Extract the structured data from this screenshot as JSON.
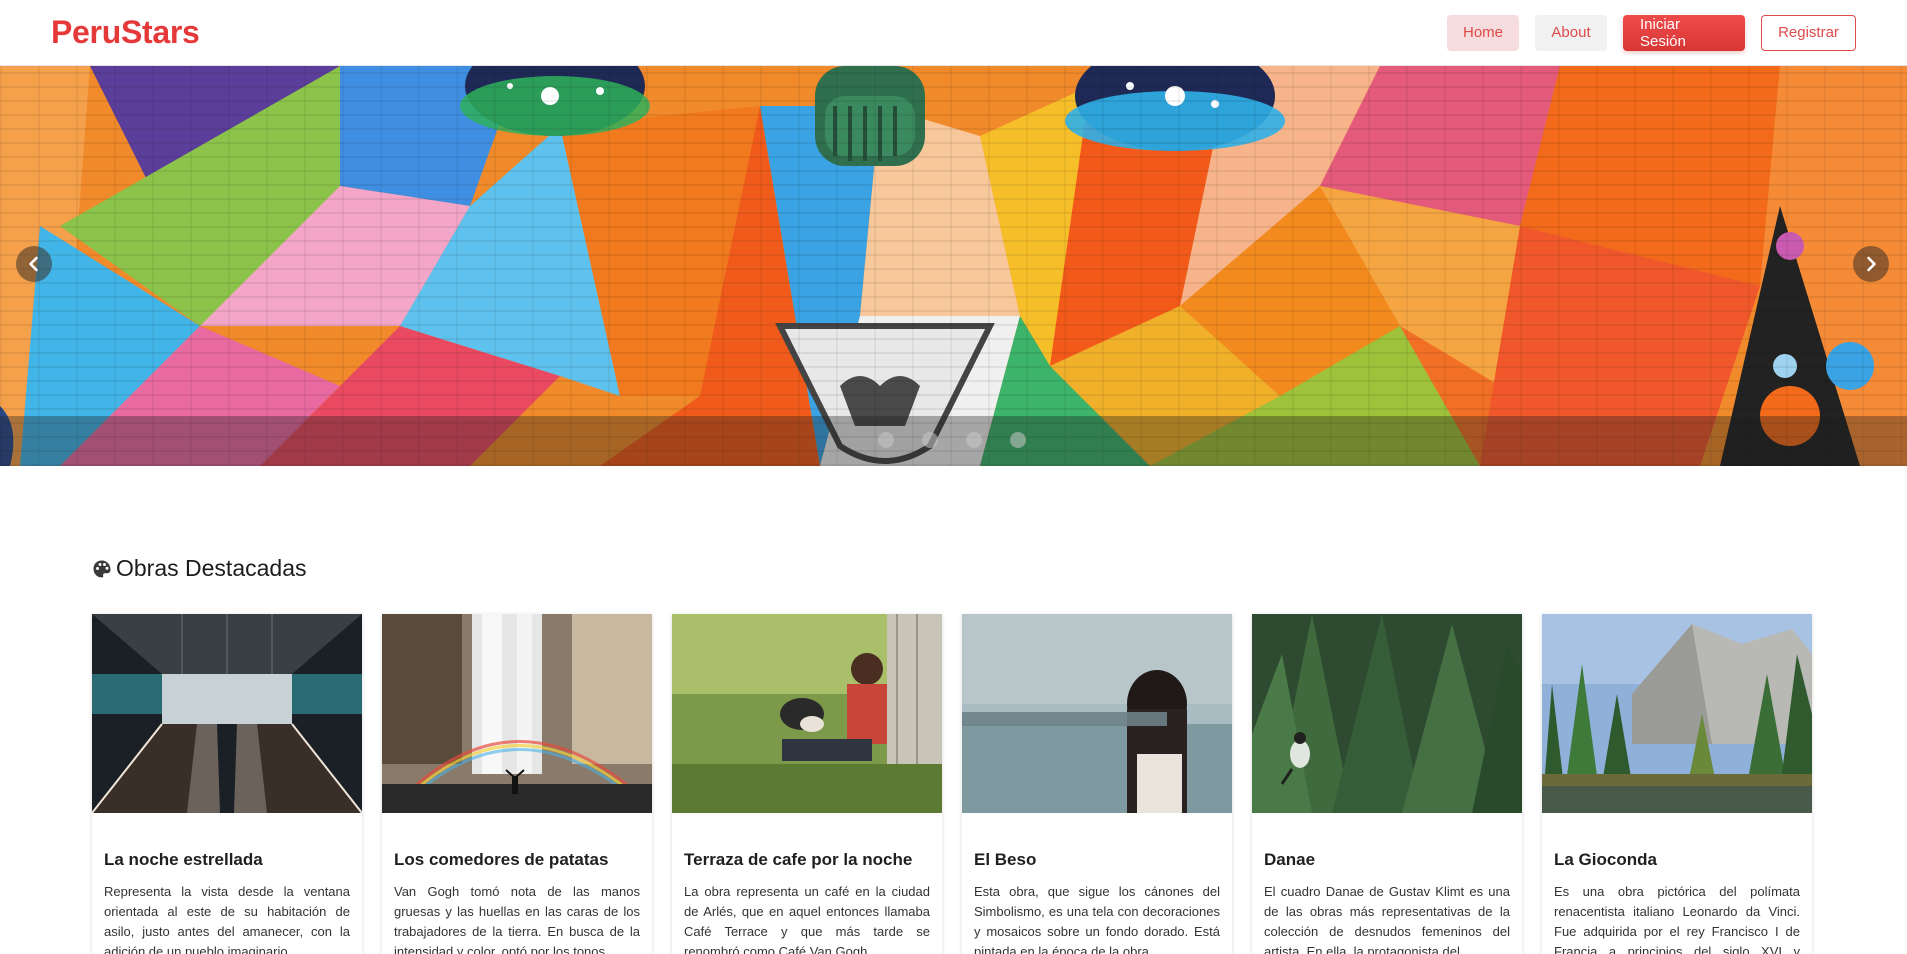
{
  "brand": {
    "name": "PeruStars"
  },
  "nav": {
    "home_label": "Home",
    "about_label": "About",
    "login_label": "Iniciar Sesión",
    "register_label": "Registrar"
  },
  "carousel": {
    "slide_count": 4,
    "prev_icon": "chevron-left-icon",
    "next_icon": "chevron-right-icon"
  },
  "section": {
    "icon": "palette-icon",
    "title": "Obras Destacadas"
  },
  "cards": [
    {
      "title": "La noche estrellada",
      "text": "Representa la vista desde la ventana orientada al este de su habitación de asilo, justo antes del amanecer, con la adición de un pueblo imaginario."
    },
    {
      "title": "Los comedores de patatas",
      "text": "Van Gogh tomó nota de las manos gruesas y las huellas en las caras de los trabajadores de la tierra. En busca de la intensidad y color, optó por los tonos..."
    },
    {
      "title": "Terraza de cafe por la noche",
      "text": "La obra representa un café en la ciudad de Arlés, que en aquel entonces llamaba Café Terrace y que más tarde se renombró como Café Van Gogh."
    },
    {
      "title": "El Beso",
      "text": "Esta obra, que sigue los cánones del Simbolismo, es una tela con decoraciones y mosaicos sobre un fondo dorado. Está pintada en la época de la obra..."
    },
    {
      "title": "Danae",
      "text": "El cuadro Danae de Gustav Klimt es una de las obras más representativas de la colección de desnudos femeninos del artista. En ella, la protagonista del..."
    },
    {
      "title": "La Gioconda",
      "text": "Es una obra pictórica del polímata renacentista italiano Leonardo da Vinci. Fue adquirida por el rey Francisco I de Francia a principios del siglo XVI y desde..."
    }
  ],
  "colors": {
    "brand": "#e53939",
    "accent_gradient_start": "#ef4b4b",
    "accent_gradient_end": "#d83535"
  }
}
